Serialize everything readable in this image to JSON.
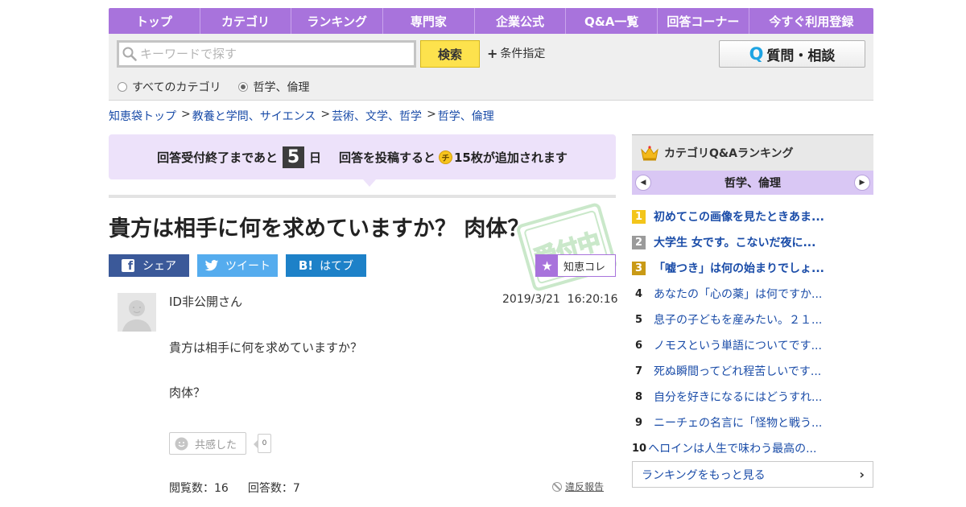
{
  "nav": [
    {
      "label": "トップ"
    },
    {
      "label": "カテゴリ"
    },
    {
      "label": "ランキング"
    },
    {
      "label": "専門家"
    },
    {
      "label": "企業公式"
    },
    {
      "label": "Q&A一覧"
    },
    {
      "label": "回答コーナー"
    },
    {
      "label": "今すぐ利用登録"
    }
  ],
  "search": {
    "placeholder": "キーワードで探す",
    "value": "",
    "button_label": "検索",
    "conditions_label": "条件指定",
    "ask_q": "Q",
    "ask_label": "質問・相談",
    "scope": [
      {
        "label": "すべてのカテゴリ",
        "selected": false
      },
      {
        "label": "哲学、倫理",
        "selected": true
      }
    ]
  },
  "breadcrumb": {
    "items": [
      "知恵袋トップ",
      "教養と学問、サイエンス",
      "芸術、文学、哲学",
      "哲学、倫理"
    ],
    "separator": ">"
  },
  "notice": {
    "prefix": "回答受付終了まであと",
    "days": "5",
    "days_unit": "日",
    "middle": "回答を投稿すると",
    "coin": "チ",
    "suffix": "15枚が追加されます"
  },
  "question": {
    "title": "貴方は相手に何を求めていますか？ 肉体？",
    "author": "ID非公開さん",
    "date": "2019/3/21  16:20:16",
    "body": [
      "貴方は相手に何を求めていますか？",
      "肉体？"
    ],
    "empathy_label": "共感した",
    "empathy_count": "0",
    "views": "閲覧数：16",
    "answers": "回答数：7",
    "report_label": "違反報告",
    "stamp_text": "受付中"
  },
  "share": {
    "facebook": "シェア",
    "twitter": "ツイート",
    "hatena": "はてブ",
    "hatena_glyph": "B!",
    "chiekore": "知恵コレ"
  },
  "ranking": {
    "title": "カテゴリQ&Aランキング",
    "category": "哲学、倫理",
    "items": [
      {
        "rank": "1",
        "text": "初めてこの画像を見たときあま..."
      },
      {
        "rank": "2",
        "text": "大学生 女です。こないだ夜に..."
      },
      {
        "rank": "3",
        "text": "「嘘つき」は何の始まりでしょ..."
      },
      {
        "rank": "4",
        "text": "あなたの「心の薬」は何ですか..."
      },
      {
        "rank": "5",
        "text": "息子の子どもを産みたい。２１..."
      },
      {
        "rank": "6",
        "text": "ノモスという単語についてです..."
      },
      {
        "rank": "7",
        "text": "死ぬ瞬間ってどれ程苦しいです..."
      },
      {
        "rank": "8",
        "text": "自分を好きになるにはどうすれ..."
      },
      {
        "rank": "9",
        "text": "ニーチェの名言に「怪物と戦う..."
      },
      {
        "rank": "10",
        "text": "ヘロインは人生で味わう最高の..."
      }
    ],
    "more_label": "ランキングをもっと見る"
  },
  "colors": {
    "brand_purple": "#a873dc",
    "notice_bg": "#ede2fa",
    "link_blue": "#1a4ca8",
    "search_yellow": "#fde24d",
    "facebook": "#3b5999",
    "twitter": "#55acee",
    "hatena": "#1d81c8"
  },
  "icons": [
    "search-icon",
    "plus-icon",
    "facebook-icon",
    "twitter-icon",
    "hatena-icon",
    "star-icon",
    "crown-icon",
    "chevron-left-icon",
    "chevron-right-icon",
    "chevron-right-icon",
    "smiley-icon",
    "prohibited-icon",
    "coin-icon"
  ]
}
